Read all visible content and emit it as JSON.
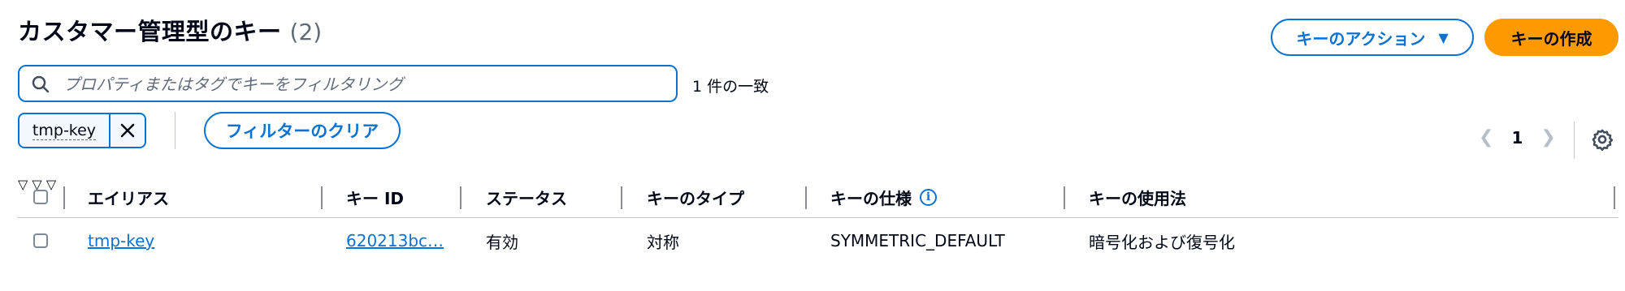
{
  "header": {
    "title": "カスタマー管理型のキー",
    "count": "(2)",
    "actions_label": "キーのアクション",
    "create_label": "キーの作成"
  },
  "filter": {
    "placeholder": "プロパティまたはタグでキーをフィルタリング",
    "value": "",
    "match_text": "1 件の一致",
    "token": "tmp-key",
    "clear_label": "フィルターのクリア"
  },
  "pagination": {
    "current": "1"
  },
  "table": {
    "headers": [
      "エイリアス",
      "キー ID",
      "ステータス",
      "キーのタイプ",
      "キーの仕様",
      "キーの使用法"
    ],
    "rows": [
      {
        "alias": "tmp-key",
        "key_id": "620213bc…",
        "status": "有効",
        "type": "対称",
        "spec": "SYMMETRIC_DEFAULT",
        "usage": "暗号化および復号化"
      }
    ]
  },
  "colors": {
    "accent": "#0972d3",
    "primary_button": "#ff9900",
    "text": "#000716",
    "secondary_text": "#5f6b7a"
  },
  "icons": [
    "search-icon",
    "caret-down-icon",
    "close-icon",
    "chevron-left-icon",
    "chevron-right-icon",
    "gear-icon",
    "sort-icon",
    "info-icon"
  ]
}
